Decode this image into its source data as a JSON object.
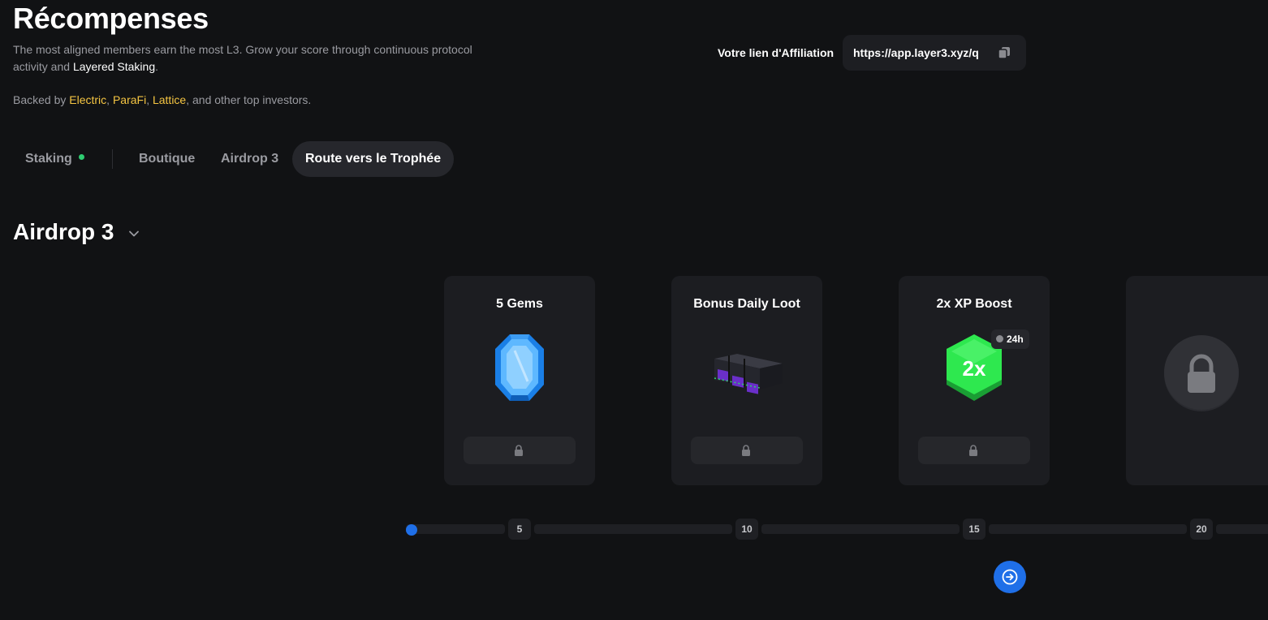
{
  "header": {
    "title": "Récompenses",
    "description_pre": "The most aligned members earn the most L3. Grow your score through continuous protocol activity and ",
    "description_highlight": "Layered Staking",
    "description_post": ".",
    "backed_pre": "Backed by ",
    "investors": [
      "Electric",
      "ParaFi",
      "Lattice"
    ],
    "backed_post": ", and other top investors."
  },
  "affiliation": {
    "label": "Votre lien d'Affiliation",
    "url": "https://app.layer3.xyz/q"
  },
  "tabs": [
    {
      "label": "Staking",
      "status_dot": true
    },
    {
      "label": "Boutique"
    },
    {
      "label": "Airdrop 3"
    },
    {
      "label": "Route vers le Trophée",
      "active": true
    }
  ],
  "section": {
    "title": "Airdrop 3"
  },
  "rewards": [
    {
      "title": "5 Gems",
      "icon": "gem-icon"
    },
    {
      "title": "Bonus Daily Loot",
      "icon": "loot-chest-icon"
    },
    {
      "title": "2x XP Boost",
      "icon": "xp-boost-icon",
      "art_text": "2x",
      "duration": "24h"
    },
    {
      "title": "",
      "icon": "lock-icon"
    }
  ],
  "progress": {
    "ticks": [
      "5",
      "10",
      "15",
      "20"
    ],
    "current_level": 0
  },
  "colors": {
    "accent": "#1f6fe8",
    "gold": "#f5c542",
    "status_green": "#2ecc71",
    "boost_green": "#2ee84f"
  }
}
